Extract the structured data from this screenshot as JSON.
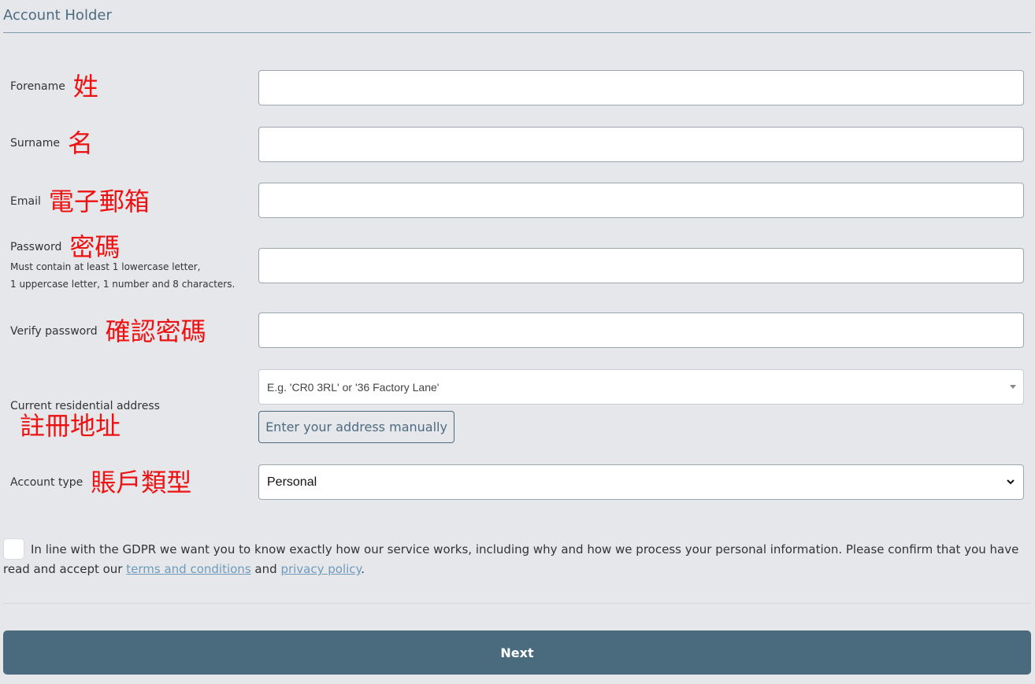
{
  "section": {
    "title": "Account Holder"
  },
  "fields": {
    "forename": {
      "label": "Forename",
      "annotation": "姓"
    },
    "surname": {
      "label": "Surname",
      "annotation": "名"
    },
    "email": {
      "label": "Email",
      "annotation": "電子郵箱"
    },
    "password": {
      "label": "Password",
      "annotation": "密碼",
      "hint_line1": "Must contain at least 1 lowercase letter,",
      "hint_line2": "1 uppercase letter, 1 number and 8 characters."
    },
    "verify_password": {
      "label": "Verify password",
      "annotation": "確認密碼"
    },
    "address": {
      "label": "Current residential address",
      "annotation": "註冊地址",
      "placeholder": "E.g. 'CR0 3RL' or '36 Factory Lane'",
      "manual_button": "Enter your address manually"
    },
    "account_type": {
      "label": "Account type",
      "annotation": "賬戶類型",
      "selected": "Personal"
    }
  },
  "gdpr": {
    "text_before": "In line with the GDPR we want you to know exactly how our service works, including why and how we process your personal information. Please confirm that you have read and accept our",
    "terms_link": "terms and conditions",
    "and_text": "and",
    "privacy_link": "privacy policy",
    "period": "."
  },
  "actions": {
    "next_label": "Next"
  },
  "colors": {
    "annotation": "#ee1111",
    "accent": "#4a6b7e",
    "link": "#6e9bbb",
    "background": "#e6e7eb"
  }
}
